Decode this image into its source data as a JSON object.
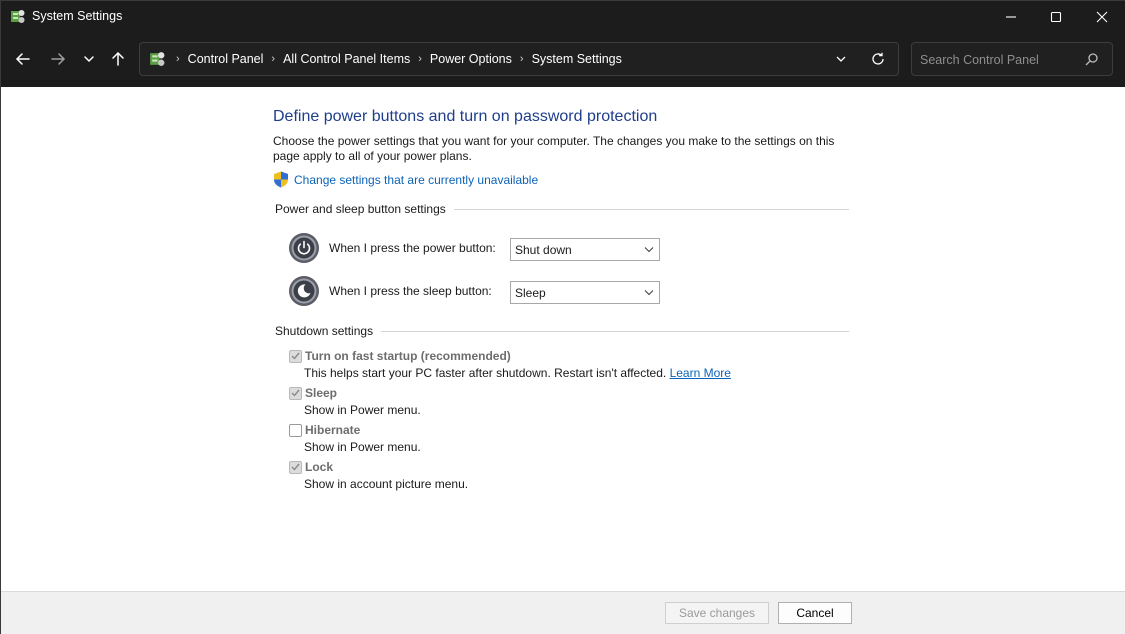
{
  "window": {
    "title": "System Settings"
  },
  "breadcrumbs": [
    "Control Panel",
    "All Control Panel Items",
    "Power Options",
    "System Settings"
  ],
  "search": {
    "placeholder": "Search Control Panel"
  },
  "page": {
    "title": "Define power buttons and turn on password protection",
    "description": "Choose the power settings that you want for your computer. The changes you make to the settings on this page apply to all of your power plans.",
    "uac_link": "Change settings that are currently unavailable"
  },
  "power_section": {
    "title": "Power and sleep button settings",
    "power_button": {
      "label": "When I press the power button:",
      "value": "Shut down"
    },
    "sleep_button": {
      "label": "When I press the sleep button:",
      "value": "Sleep"
    }
  },
  "shutdown_section": {
    "title": "Shutdown settings",
    "options": [
      {
        "title": "Turn on fast startup (recommended)",
        "desc": "This helps start your PC faster after shutdown. Restart isn't affected.",
        "link": "Learn More",
        "checked": true
      },
      {
        "title": "Sleep",
        "desc": "Show in Power menu.",
        "checked": true
      },
      {
        "title": "Hibernate",
        "desc": "Show in Power menu.",
        "checked": false
      },
      {
        "title": "Lock",
        "desc": "Show in account picture menu.",
        "checked": true
      }
    ]
  },
  "footer": {
    "save_label": "Save changes",
    "cancel_label": "Cancel"
  },
  "colors": {
    "titlebar": "#1c1c1c",
    "heading": "#1e3e8c",
    "link": "#0b63b8"
  },
  "icons": [
    "control-panel-icon",
    "minimize-icon",
    "maximize-icon",
    "close-icon",
    "back-arrow-icon",
    "forward-arrow-icon",
    "recent-locations-chevron-icon",
    "up-arrow-icon",
    "address-dropdown-icon",
    "refresh-icon",
    "search-icon",
    "uac-shield-icon",
    "power-button-icon",
    "sleep-button-icon"
  ]
}
